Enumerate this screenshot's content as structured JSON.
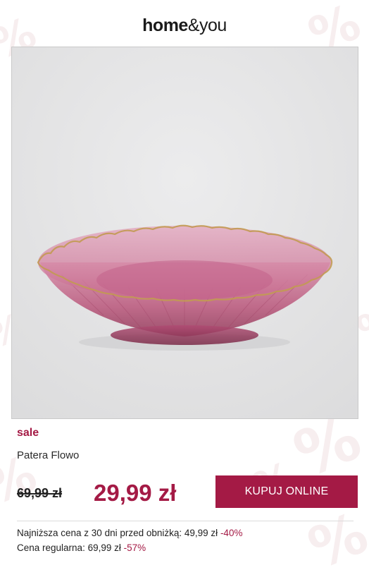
{
  "brand": {
    "home": "home",
    "amp": "&",
    "you": "you"
  },
  "product": {
    "tag": "sale",
    "name": "Patera Flowo",
    "old_price": "69,99 zł",
    "price": "29,99 zł",
    "buy_label": "KUPUJ ONLINE"
  },
  "info": {
    "lowest_label": "Najniższa cena z 30 dni przed obniżką: 49,99 zł",
    "lowest_discount": "-40%",
    "regular_label": "Cena regularna: 69,99 zł",
    "regular_discount": "-57%"
  },
  "colors": {
    "accent": "#a41a45",
    "bowl": "#c05a7e",
    "rim": "#c29a52",
    "hero_bg": "#e5e5e6"
  },
  "background_glyph": "%",
  "image": {
    "subject": "pink-glass-scalloped-bowl"
  }
}
